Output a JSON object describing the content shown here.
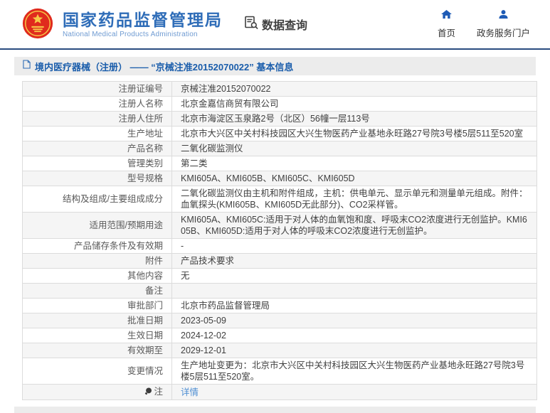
{
  "header": {
    "title": "国家药品监督管理局",
    "subtitle": "National Medical Products Administration",
    "nav_query": "数据查询",
    "nav_home": "首页",
    "nav_portal": "政务服务门户"
  },
  "breadcrumb": {
    "text": "境内医疗器械（注册） —— “京械注准20152070022” 基本信息"
  },
  "colors": {
    "brand_blue": "#2f6db8",
    "icon_blue": "#1e5bb5",
    "link_blue": "#4f8fd3",
    "header_rule": "#2a4c80",
    "stripe_gray": "#f5f5f5",
    "bar_gray": "#ececec",
    "emblem_red": "#e02b1d",
    "emblem_gold": "#f7c948"
  },
  "table": {
    "rows": [
      {
        "label": "注册证编号",
        "value": "京械注准20152070022"
      },
      {
        "label": "注册人名称",
        "value": "北京金嘉信商贸有限公司"
      },
      {
        "label": "注册人住所",
        "value": "北京市海淀区玉泉路2号（北区）56幢一层113号"
      },
      {
        "label": "生产地址",
        "value": "北京市大兴区中关村科技园区大兴生物医药产业基地永旺路27号院3号楼5层511至520室"
      },
      {
        "label": "产品名称",
        "value": "二氧化碳监测仪"
      },
      {
        "label": "管理类别",
        "value": "第二类"
      },
      {
        "label": "型号规格",
        "value": "KMI605A、KMI605B、KMI605C、KMI605D"
      },
      {
        "label": "结构及组成/主要组成成分",
        "value": "二氧化碳监测仪由主机和附件组成，主机：供电单元、显示单元和测量单元组成。附件：血氧探头(KMI605B、KMI605D无此部分)、CO2采样管。"
      },
      {
        "label": "适用范围/预期用途",
        "value": "KMI605A、KMI605C:适用于对人体的血氧饱和度、呼吸末CO2浓度进行无创监护。KMI605B、KMI605D:适用于对人体的呼吸末CO2浓度进行无创监护。"
      },
      {
        "label": "产品储存条件及有效期",
        "value": "-"
      },
      {
        "label": "附件",
        "value": "产品技术要求"
      },
      {
        "label": "其他内容",
        "value": "无"
      },
      {
        "label": "备注",
        "value": ""
      },
      {
        "label": "审批部门",
        "value": "北京市药品监督管理局"
      },
      {
        "label": "批准日期",
        "value": "2023-05-09"
      },
      {
        "label": "生效日期",
        "value": "2024-12-02"
      },
      {
        "label": "有效期至",
        "value": "2029-12-01"
      },
      {
        "label": "变更情况",
        "value": "生产地址变更为：北京市大兴区中关村科技园区大兴生物医药产业基地永旺路27号院3号楼5层511至520室。"
      },
      {
        "label": "注",
        "value": "详情",
        "link": true,
        "icon": "bulb-icon"
      }
    ]
  }
}
